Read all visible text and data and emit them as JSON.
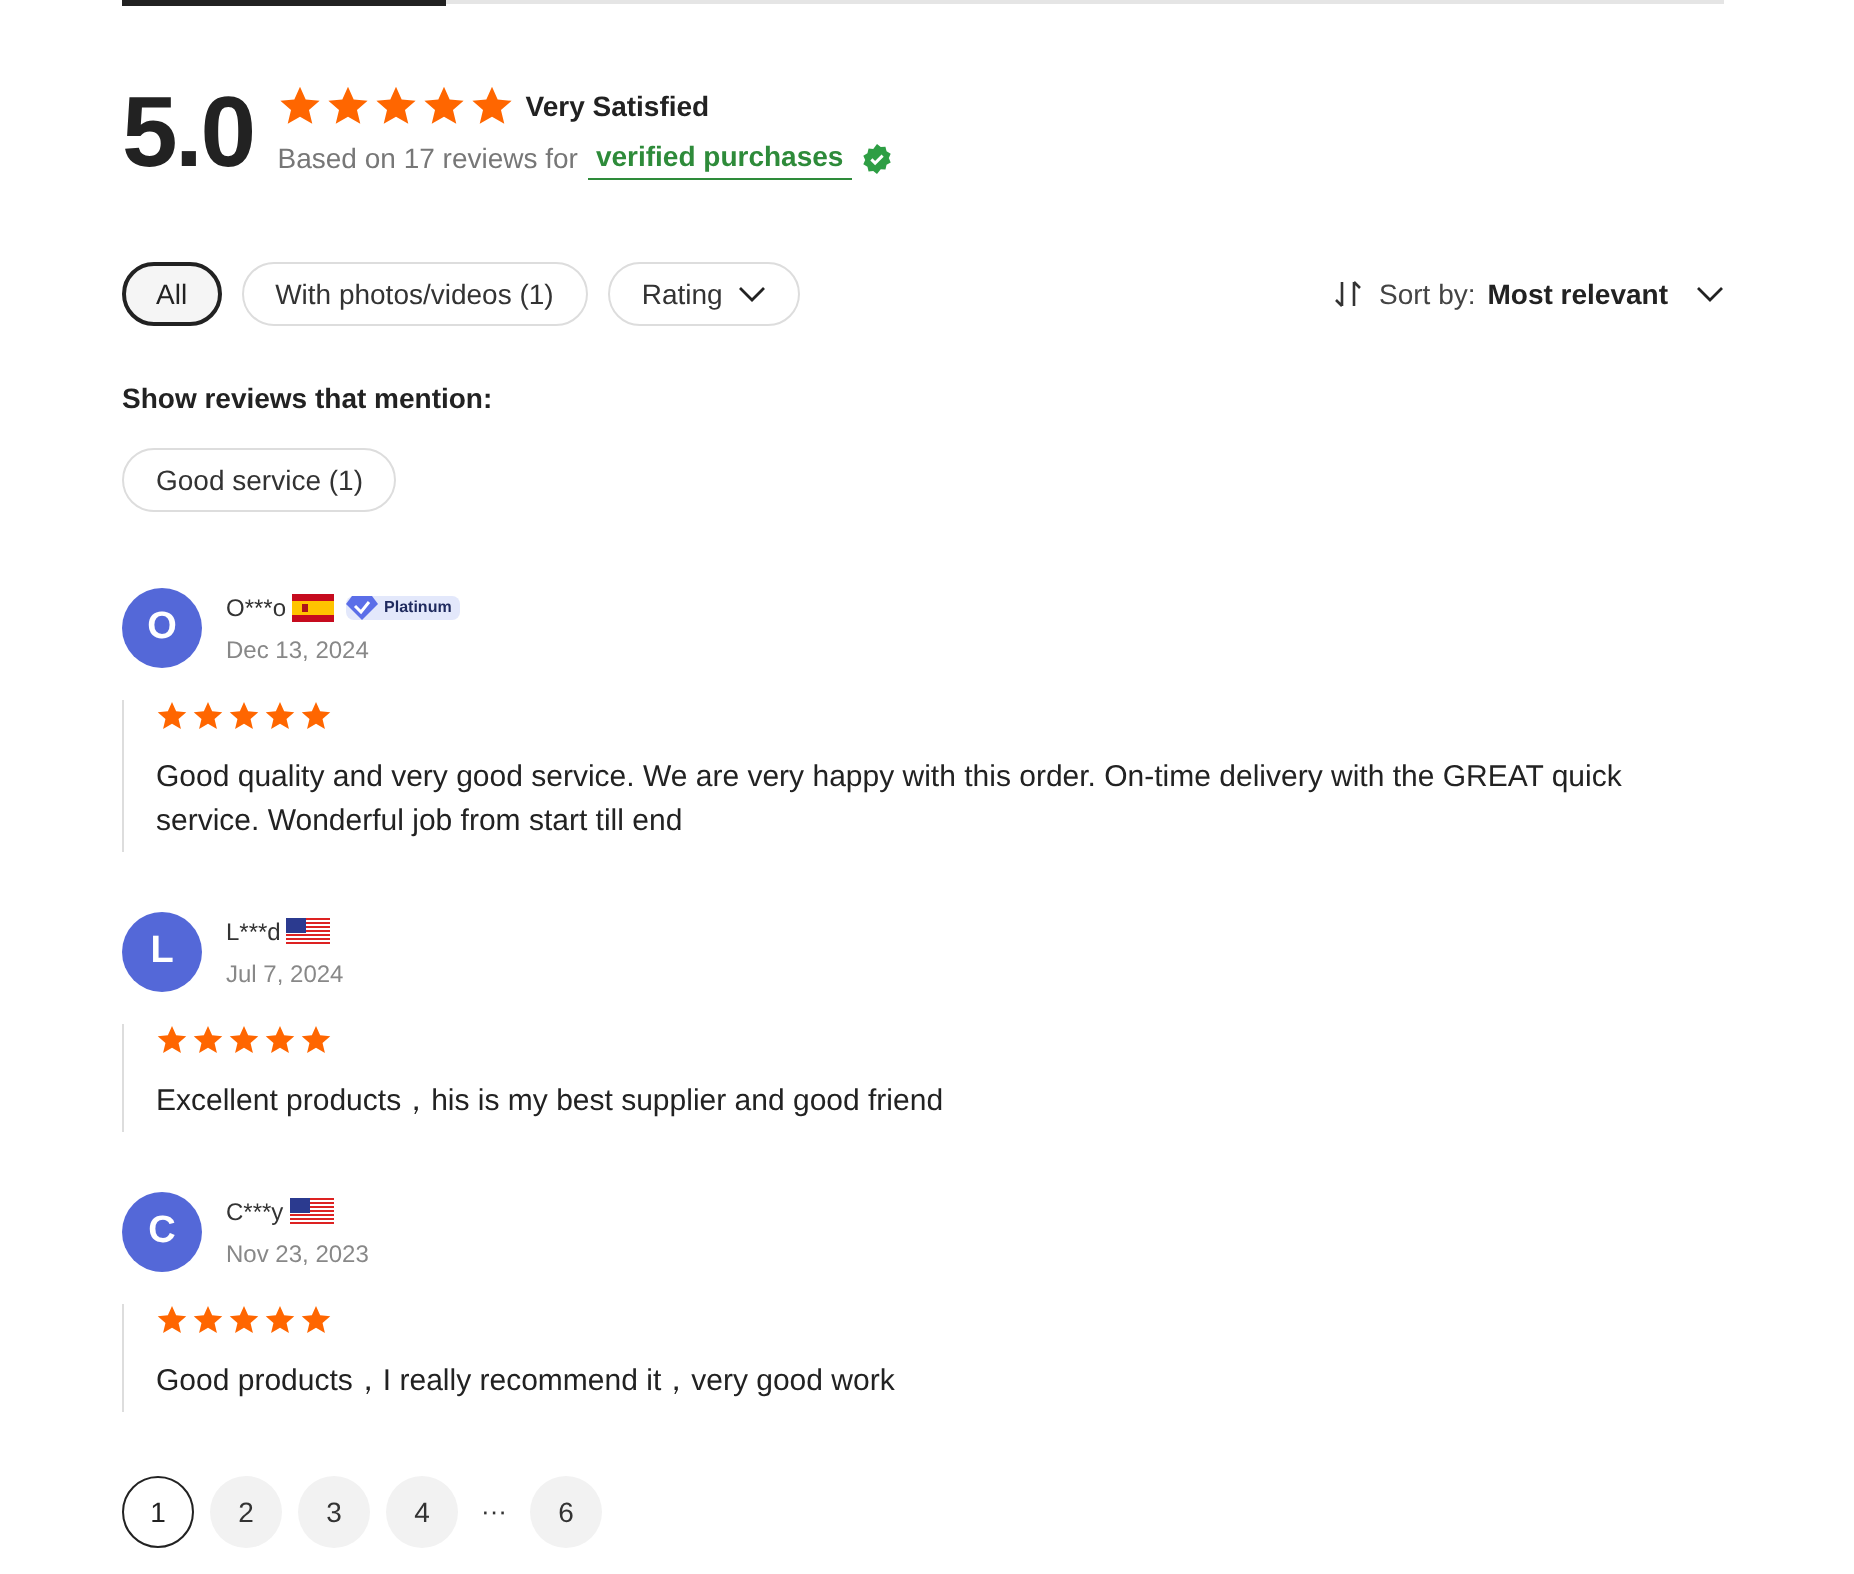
{
  "summary": {
    "score": "5.0",
    "stars": 5,
    "label": "Very Satisfied",
    "based_on": "Based on 17 reviews for",
    "verified": "verified purchases"
  },
  "filters": [
    {
      "label": "All",
      "selected": true,
      "dropdown": false
    },
    {
      "label": "With photos/videos (1)",
      "selected": false,
      "dropdown": false
    },
    {
      "label": "Rating",
      "selected": false,
      "dropdown": true
    }
  ],
  "sort": {
    "prefix": "Sort by:",
    "value": "Most relevant"
  },
  "mentions": {
    "heading": "Show reviews that mention:",
    "tags": [
      "Good service (1)"
    ]
  },
  "reviews": [
    {
      "initial": "O",
      "name": "O***o",
      "flag": {
        "kind": "spain"
      },
      "badge": "Platinum",
      "date": "Dec 13, 2024",
      "stars": 5,
      "text": "Good quality and very good service. We are very happy with this order. On-time delivery with the GREAT quick service. Wonderful job from start till end"
    },
    {
      "initial": "L",
      "name": "L***d",
      "flag": {
        "kind": "usa"
      },
      "date": "Jul 7, 2024",
      "stars": 5,
      "text": "Excellent products，his is my best supplier and good friend"
    },
    {
      "initial": "C",
      "name": "C***y",
      "flag": {
        "kind": "usa"
      },
      "date": "Nov 23, 2023",
      "stars": 5,
      "text": "Good products，I really recommend it，very good work"
    }
  ],
  "pagination": [
    {
      "label": "1",
      "selected": true
    },
    {
      "label": "2",
      "selected": false
    },
    {
      "label": "3",
      "selected": false
    },
    {
      "label": "4",
      "selected": false
    },
    {
      "label": "···",
      "kind": "ellipsis"
    },
    {
      "label": "6",
      "selected": false
    }
  ]
}
